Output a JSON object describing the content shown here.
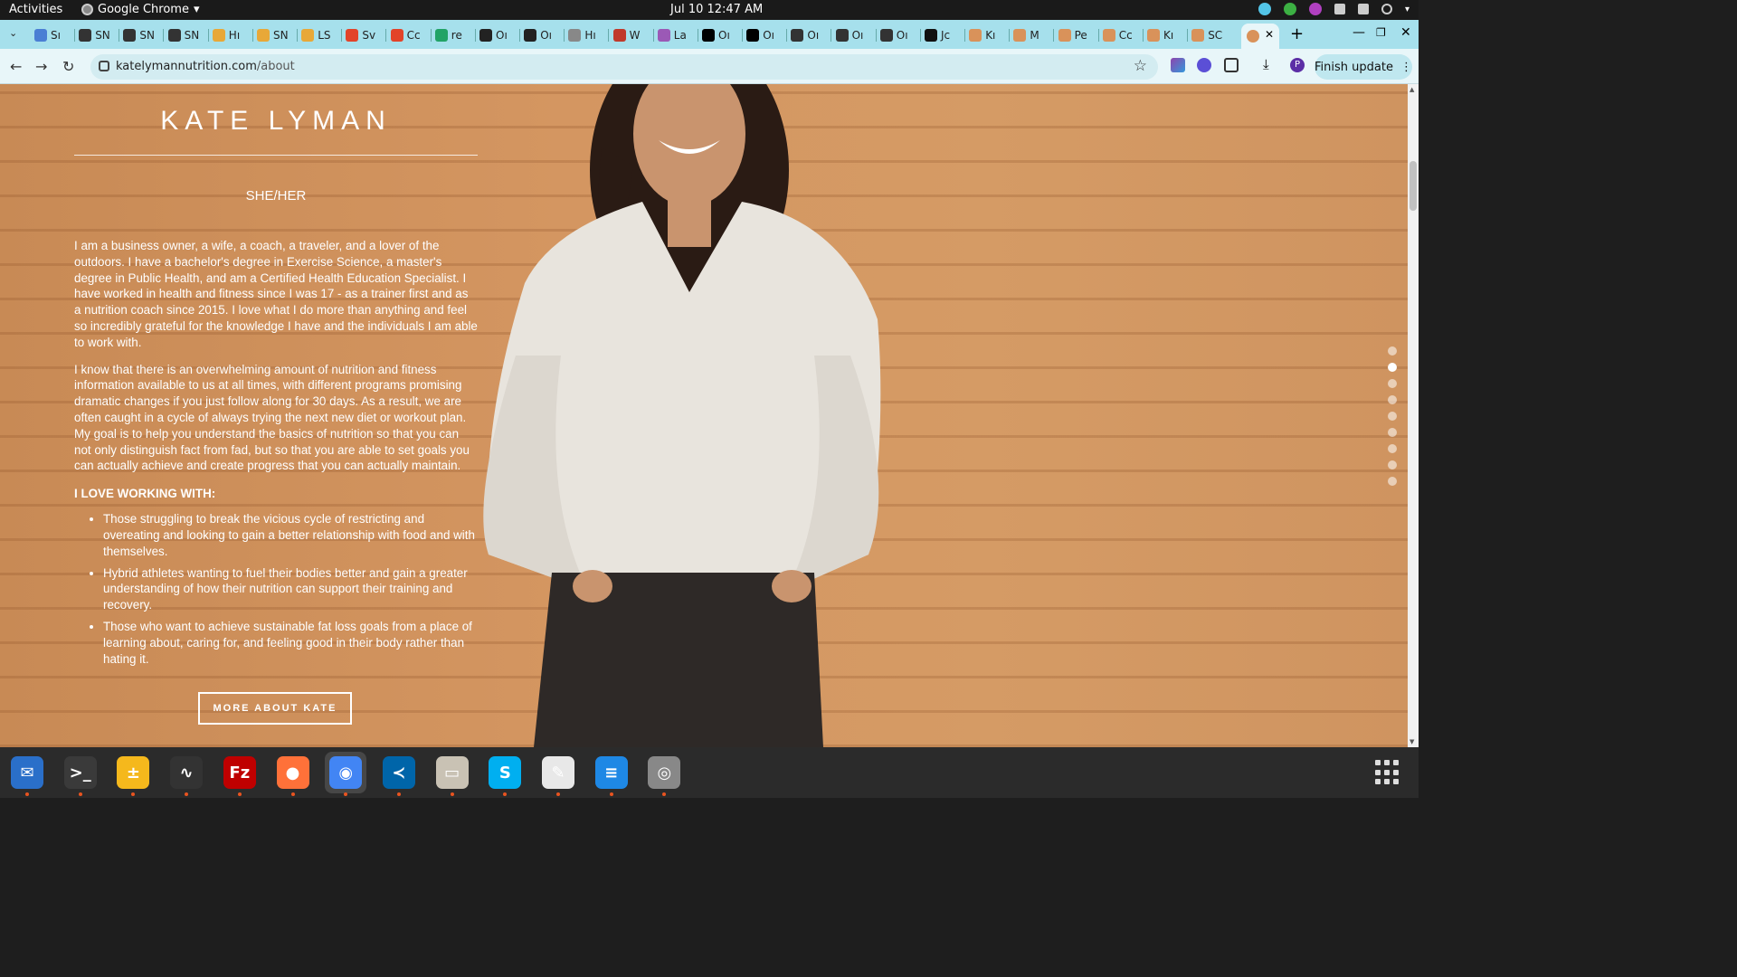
{
  "os": {
    "activities": "Activities",
    "app_name": "Google Chrome",
    "clock": "Jul 10  12:47 AM"
  },
  "browser": {
    "tabs": [
      {
        "label": "Sı",
        "color": "#4a7fd4"
      },
      {
        "label": "SN",
        "color": "#333333"
      },
      {
        "label": "SN",
        "color": "#333333"
      },
      {
        "label": "SN",
        "color": "#333333"
      },
      {
        "label": "Hı",
        "color": "#e8a838"
      },
      {
        "label": "SN",
        "color": "#e8a838"
      },
      {
        "label": "LS",
        "color": "#e8a838"
      },
      {
        "label": "Sv",
        "color": "#e24329"
      },
      {
        "label": "Cc",
        "color": "#e24329"
      },
      {
        "label": "re",
        "color": "#21a366"
      },
      {
        "label": "Oı",
        "color": "#222222"
      },
      {
        "label": "Oı",
        "color": "#222222"
      },
      {
        "label": "Hı",
        "color": "#888888"
      },
      {
        "label": "W",
        "color": "#c0392b"
      },
      {
        "label": "La",
        "color": "#9b59b6"
      },
      {
        "label": "Oı",
        "color": "#000000"
      },
      {
        "label": "Oı",
        "color": "#000000"
      },
      {
        "label": "Oı",
        "color": "#333333"
      },
      {
        "label": "Oı",
        "color": "#333333"
      },
      {
        "label": "Oı",
        "color": "#333333"
      },
      {
        "label": "Jc",
        "color": "#111111"
      },
      {
        "label": "Kı",
        "color": "#d9925a"
      },
      {
        "label": "M",
        "color": "#d9925a"
      },
      {
        "label": "Pe",
        "color": "#d9925a"
      },
      {
        "label": "Cc",
        "color": "#d9925a"
      },
      {
        "label": "Kı",
        "color": "#d9925a"
      },
      {
        "label": "SC",
        "color": "#d9925a"
      }
    ],
    "active_tab_close": "✕",
    "new_tab": "+",
    "url_host": "katelymannutrition.com",
    "url_path": "/about",
    "finish_update": "Finish update",
    "profile_initial": "P"
  },
  "page": {
    "site_title": "KATE LYMAN",
    "pronouns": "SHE/HER",
    "para1": "I am a business owner, a wife, a coach, a traveler, and a lover of the outdoors. I have a bachelor's degree in Exercise Science, a master's degree in Public Health, and am a Certified Health Education Specialist. I have worked in health and fitness since I was 17 - as a trainer first and as a nutrition coach since 2015. I love what I do more than anything and feel so incredibly grateful for the knowledge I have and the individuals I am able to work with.",
    "para2": "I know that there is an overwhelming amount of nutrition and fitness information available to us at all times, with different programs promising dramatic changes if you just follow along for 30 days. As a result, we are often caught in a cycle of always trying the next new diet or workout plan. My goal is to help you understand the basics of nutrition so that you can not only distinguish fact from fad, but so that you are able to set goals you can actually achieve and create progress that you can actually maintain.",
    "love_heading": "I LOVE WORKING WITH:",
    "love_items": [
      "Those struggling to break the vicious cycle of restricting and overeating and looking to gain a better relationship with food and with themselves.",
      "Hybrid athletes wanting to fuel their bodies better and gain a greater understanding of how their nutrition can support their training and recovery.",
      "Those who want to achieve sustainable fat loss goals from a place of learning about, caring for, and feeling good in their body rather than hating it."
    ],
    "more_button": "MORE ABOUT KATE",
    "section_dots_total": 9,
    "section_dots_active": 2
  },
  "dock": {
    "apps": [
      {
        "name": "thunderbird",
        "color": "#2a6fc9",
        "glyph": "✉"
      },
      {
        "name": "terminal",
        "color": "#3a3a3a",
        "glyph": ">_"
      },
      {
        "name": "calculator",
        "color": "#f5b81c",
        "glyph": "±"
      },
      {
        "name": "system-monitor",
        "color": "#333333",
        "glyph": "∿"
      },
      {
        "name": "filezilla",
        "color": "#bf0000",
        "glyph": "Fz"
      },
      {
        "name": "firefox",
        "color": "#ff7139",
        "glyph": "●"
      },
      {
        "name": "chrome",
        "color": "#4285f4",
        "glyph": "◉"
      },
      {
        "name": "vscode",
        "color": "#0065a9",
        "glyph": "≺"
      },
      {
        "name": "files",
        "color": "#c9c2b4",
        "glyph": "▭"
      },
      {
        "name": "skype",
        "color": "#00aff0",
        "glyph": "S"
      },
      {
        "name": "text-editor",
        "color": "#e8e8e8",
        "glyph": "✎"
      },
      {
        "name": "document-viewer",
        "color": "#1e88e5",
        "glyph": "≡"
      },
      {
        "name": "disks",
        "color": "#888888",
        "glyph": "◎"
      }
    ]
  }
}
